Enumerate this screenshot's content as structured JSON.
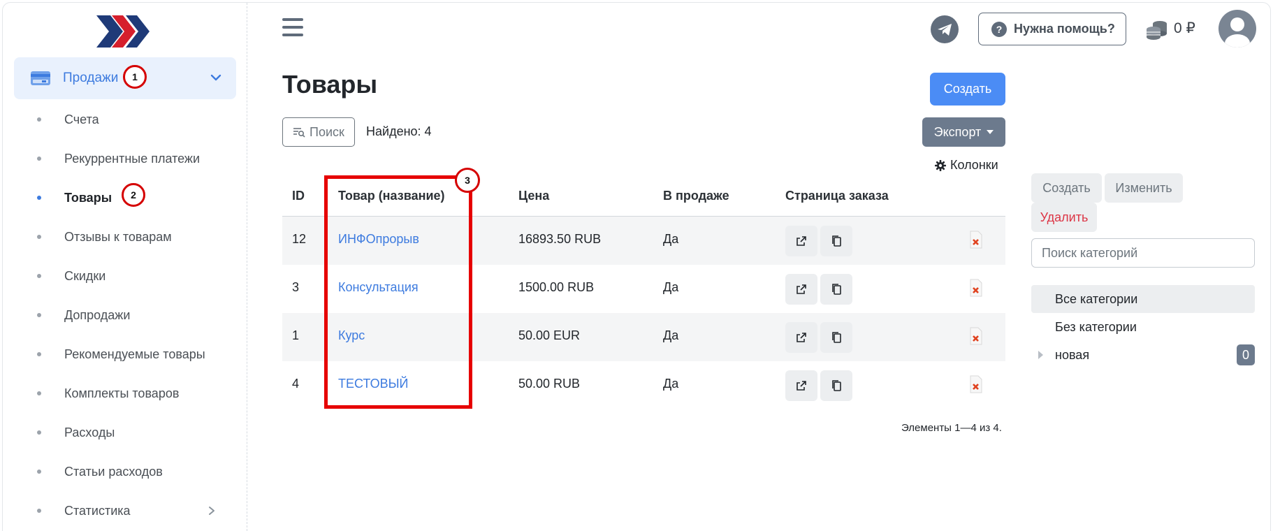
{
  "sidebar": {
    "main_item": "Продажи",
    "items": [
      {
        "label": "Счета"
      },
      {
        "label": "Рекуррентные платежи"
      },
      {
        "label": "Товары"
      },
      {
        "label": "Отзывы к товарам"
      },
      {
        "label": "Скидки"
      },
      {
        "label": "Допродажи"
      },
      {
        "label": "Рекомендуемые товары"
      },
      {
        "label": "Комплекты товаров"
      },
      {
        "label": "Расходы"
      },
      {
        "label": "Статьи расходов"
      },
      {
        "label": "Статистика"
      }
    ],
    "active_item": "Товары"
  },
  "annotations": {
    "one": "1",
    "two": "2",
    "three": "3"
  },
  "header": {
    "help_label": "Нужна помощь?",
    "help_icon": "?",
    "balance": "0 ₽"
  },
  "main": {
    "title": "Товары",
    "create_label": "Создать",
    "search_label": "Поиск",
    "found_text": "Найдено: 4",
    "export_label": "Экспорт",
    "columns_label": "Колонки",
    "table": {
      "headers": [
        "ID",
        "Товар (название)",
        "Цена",
        "В продаже",
        "Страница заказа"
      ],
      "rows": [
        {
          "id": "12",
          "name": "ИНФОпрорыв",
          "price": "16893.50 RUB",
          "on_sale": "Да"
        },
        {
          "id": "3",
          "name": "Консультация",
          "price": "1500.00 RUB",
          "on_sale": "Да"
        },
        {
          "id": "1",
          "name": "Курс",
          "price": "50.00 EUR",
          "on_sale": "Да"
        },
        {
          "id": "4",
          "name": "ТЕСТОВЫЙ",
          "price": "50.00 RUB",
          "on_sale": "Да"
        }
      ]
    },
    "pagination": "Элементы 1—4 из 4."
  },
  "categories": {
    "create_label": "Создать",
    "edit_label": "Изменить",
    "delete_label": "Удалить",
    "search_placeholder": "Поиск категорий",
    "items": [
      {
        "label": "Все категории"
      },
      {
        "label": "Без категории"
      },
      {
        "label": "новая",
        "count": "0"
      }
    ]
  },
  "colors": {
    "accent": "#3d7bdf",
    "primary_button": "#4b8cf5",
    "secondary_button": "#6c7a8d",
    "annotation_red": "#e60000",
    "danger": "#dc3545"
  },
  "icons": [
    "logo-chevrons-icon",
    "credit-card-icon",
    "chevron-down-icon",
    "chevron-right-icon",
    "hamburger-icon",
    "telegram-icon",
    "question-icon",
    "coins-icon",
    "avatar-icon",
    "search-filter-icon",
    "gear-icon",
    "external-link-icon",
    "copy-icon",
    "delete-icon",
    "tree-expand-icon"
  ]
}
